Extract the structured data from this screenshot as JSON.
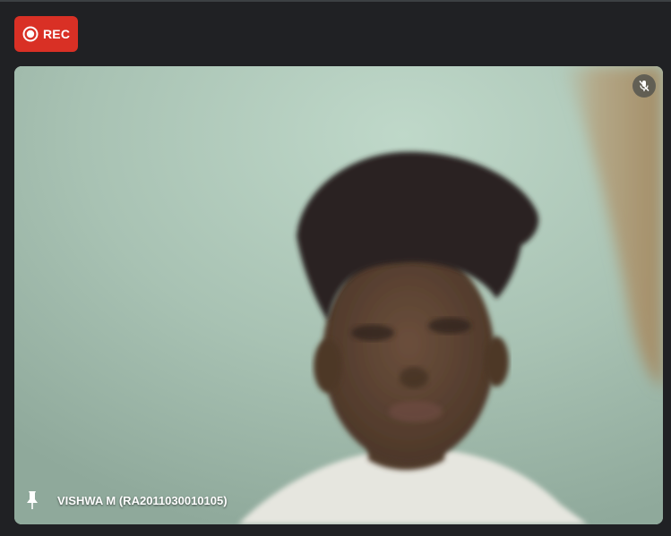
{
  "recording": {
    "label": "REC",
    "icon": "record-icon",
    "color": "#d93025"
  },
  "tile": {
    "participant_name": "VISHWA M (RA2011030010105)",
    "mic_state_icon": "mic-off-icon",
    "pin_icon": "pin-icon"
  },
  "theme": {
    "background": "#202124",
    "wall": "#a9c3b4"
  }
}
